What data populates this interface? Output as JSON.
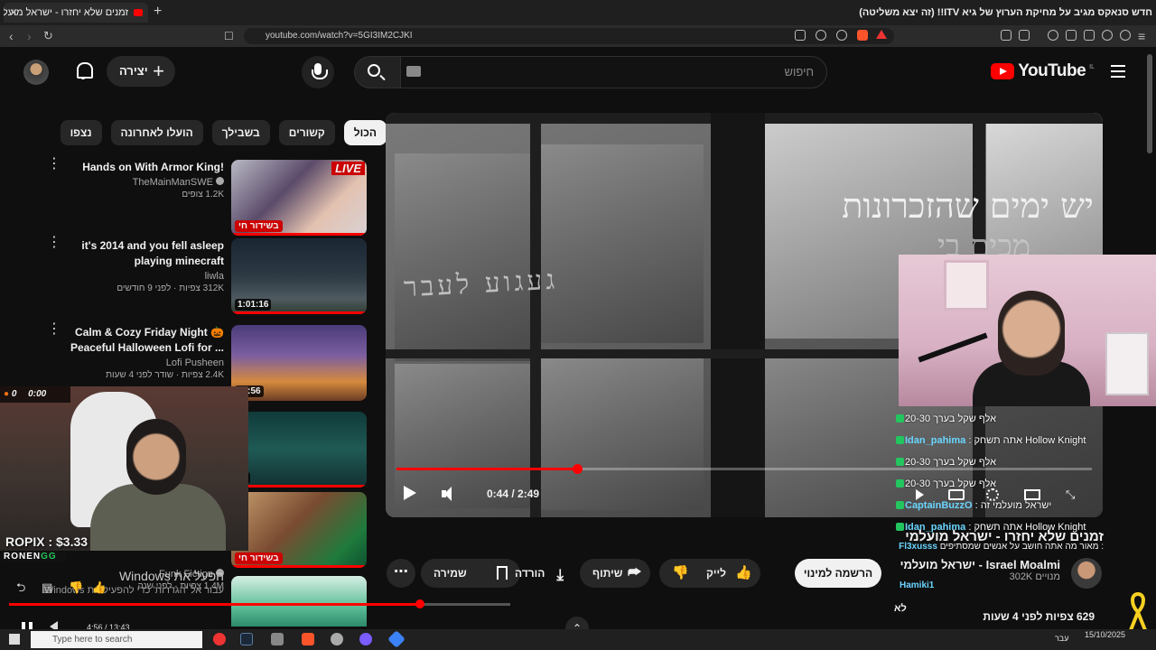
{
  "browser": {
    "tab_title": "זמנים שלא יחזרו - ישראל מועלמי",
    "window_title": "חדש סנאקס מגיב על מחיקת הערוץ של גיא ITV!! (זה יצא משליטה)",
    "url": "youtube.com/watch?v=5GI3IM2CJKI"
  },
  "masthead": {
    "logo": "YouTube",
    "logo_region": "IL",
    "search_placeholder": "חיפוש",
    "create_label": "יצירה"
  },
  "chips": [
    "הכול",
    "קשורים",
    "בשבילך",
    "הועלו לאחרונה",
    "נצפו"
  ],
  "recommendations": [
    {
      "title": "Hands on With Armor King!",
      "channel": "TheMainManSWE",
      "meta": "1.2K צופים",
      "badge": "בשידור חי",
      "live": "LIVE",
      "verified": true
    },
    {
      "title": "it's 2014 and you fell asleep playing minecraft",
      "channel": "liwla",
      "meta": "312K צפיות · לפני 9 חודשים",
      "duration": "1:01:16"
    },
    {
      "title": "Calm & Cozy Friday Night 🎃 Peaceful Halloween Lofi for ...",
      "channel": "Lofi Pusheen",
      "meta": "2.4K צפיות · שודר לפני 4 שעות",
      "duration": "54:56"
    },
    {
      "title": "",
      "channel": "",
      "meta": "",
      "duration": "38"
    },
    {
      "title": "",
      "channel": "",
      "meta": "",
      "badge": "בשידור חי"
    },
    {
      "title": "הפעל את Windows",
      "channel": "Funk Fiction",
      "meta": "1.4M צפיות · לפני שנה",
      "subtitle": "עבור אל 'הגדרות' כדי להפעיל את Windows."
    }
  ],
  "player": {
    "overlay_text_1": "יש ימים שהזכרונות",
    "overlay_text_2": "מכים בי",
    "glass_text": "געגוע לעבר",
    "time_current": "0:44",
    "time_total": "2:49",
    "time_display": "0:44 / 2:49",
    "progress": 0.26
  },
  "chat": [
    {
      "user": "",
      "msg": "אלף שקל בערך 20-30"
    },
    {
      "user": "Idan_pahima",
      "msg": ": אתה תשחק Hollow Knight"
    },
    {
      "user": "",
      "msg": "אלף שקל בערך 20-30"
    },
    {
      "user": "",
      "msg": "אלף שקל בערך 20-30"
    },
    {
      "user": "CaptainBuzzO",
      "msg": ": ישראל מועלמי זה"
    },
    {
      "user": "Idan_pahima",
      "msg": ": אתה תשחק Hollow Knight"
    },
    {
      "user": "Fl3xusss",
      "msg": ": מאור מה אתה חושב על אנשים שמסתיפים"
    },
    {
      "user": "",
      "msg": ""
    },
    {
      "user": "Hamiki1",
      "msg": ""
    }
  ],
  "video": {
    "title": "זמנים שלא יחזרו - ישראל מועלמי",
    "channel": "Israel Moalmi - ישראל מועלמי",
    "subscribers": "302K",
    "subscribe_label": "הרשמה למינוי",
    "views_line": "629 צפיות  לפני 4 שעות",
    "views_more": "לא",
    "like_label": "לייק",
    "share_label": "שיתוף",
    "download_label": "הורדה",
    "save_label": "שמירה"
  },
  "streamer": {
    "donation": "ROPIX : $3.33",
    "tag_prefix": "RONEN",
    "tag_suffix": "GG",
    "cam_counter": "0",
    "cam_time": "0:00"
  },
  "outer_player": {
    "time": "4:56 / 13:43",
    "progress": 0.82
  },
  "taskbar": {
    "search_placeholder": "Type here to search",
    "date": "15/10/2025",
    "lang": "עבר"
  },
  "colors": {
    "youtube_red": "#ff0000",
    "chat_green": "#22c55e",
    "background": "#0f0f0f"
  }
}
